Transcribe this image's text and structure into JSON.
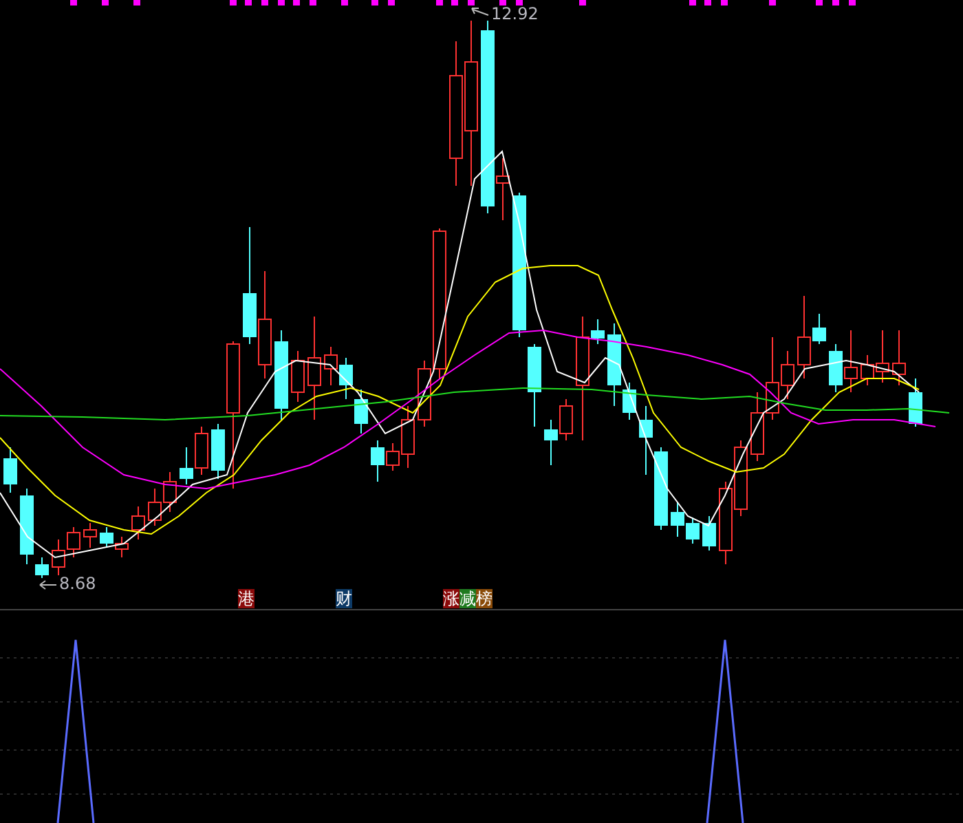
{
  "price_labels": [
    {
      "kind": "high",
      "text": "12.92"
    },
    {
      "kind": "low",
      "text": "8.68"
    }
  ],
  "event_tags": [
    {
      "text": "港",
      "color": "#8b0a0a"
    },
    {
      "text": "财",
      "color": "#0d3a66"
    },
    {
      "text": "涨",
      "color": "#8b0a0a"
    },
    {
      "text": "减",
      "color": "#1f7a1f"
    },
    {
      "text": "榜",
      "color": "#8a4b08"
    }
  ]
}
